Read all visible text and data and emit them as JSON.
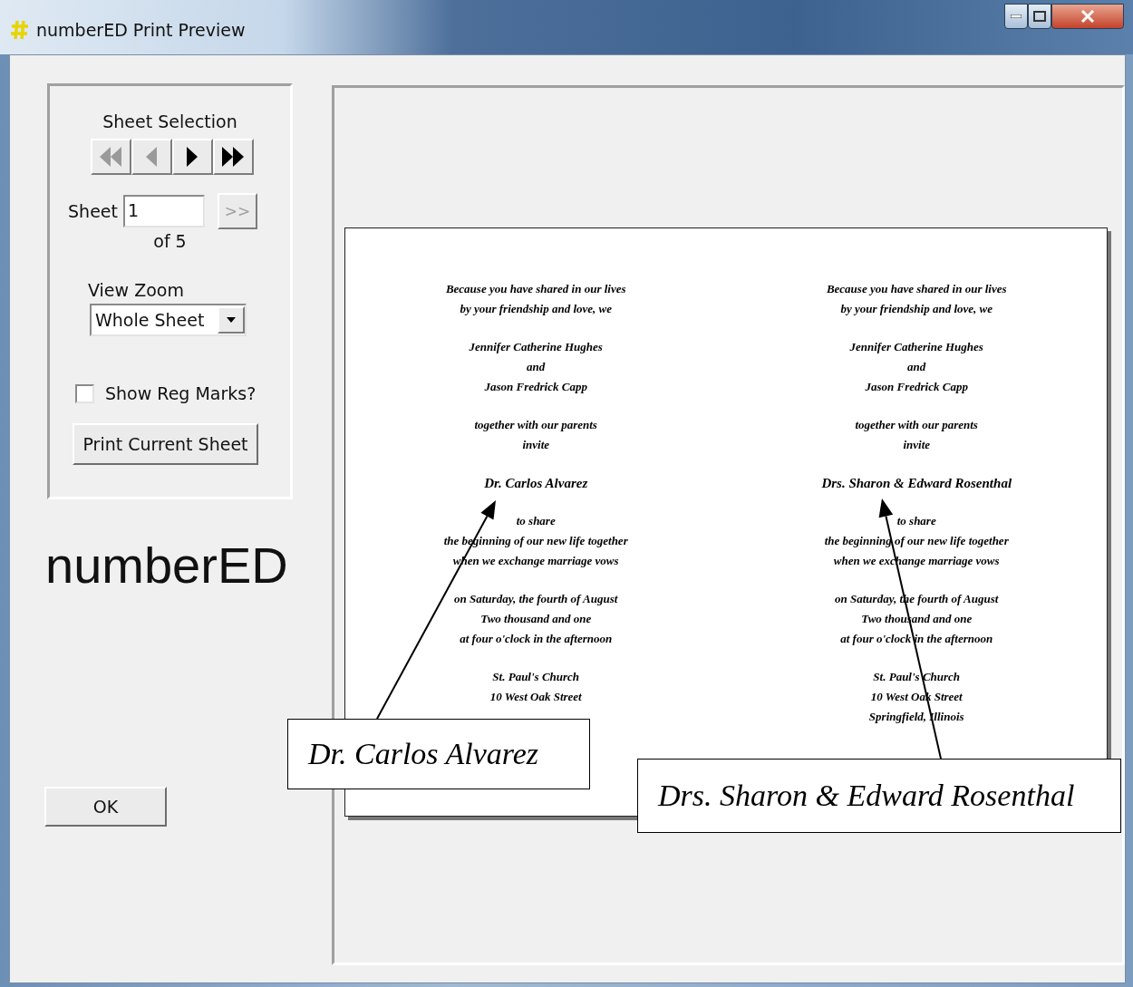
{
  "window": {
    "title": "numberED Print Preview"
  },
  "sheet_selection": {
    "title": "Sheet Selection",
    "nav_buttons": [
      {
        "kind": "first",
        "disabled": true
      },
      {
        "kind": "prev",
        "disabled": true
      },
      {
        "kind": "next",
        "disabled": false
      },
      {
        "kind": "last",
        "disabled": false
      }
    ],
    "sheet_label": "Sheet",
    "sheet_value": "1",
    "go_button": {
      "label": ">>",
      "disabled": true
    },
    "of_label": "of 5",
    "zoom_label": "View Zoom",
    "zoom_value": "Whole Sheet",
    "reg_marks": {
      "label": "Show Reg Marks?",
      "checked": false
    },
    "print_button": "Print Current Sheet"
  },
  "logo": "numberED",
  "ok_button": "OK",
  "sheet": {
    "columns": [
      {
        "blocks": [
          [
            "Because you have shared in our lives",
            "by your friendship and love, we"
          ],
          [
            "Jennifer Catherine Hughes",
            "and",
            "Jason Fredrick Capp"
          ],
          [
            "together with our parents",
            "invite"
          ],
          [
            "Dr. Carlos Alvarez"
          ],
          [
            "to share",
            "the beginning of our new life together",
            "when we exchange marriage vows"
          ],
          [
            "on Saturday, the fourth of August",
            "Two thousand and one",
            "at four o'clock in the afternoon"
          ],
          [
            "St. Paul's Church",
            "10 West Oak Street"
          ]
        ]
      },
      {
        "blocks": [
          [
            "Because you have shared in our lives",
            "by your friendship and love, we"
          ],
          [
            "Jennifer Catherine Hughes",
            "and",
            "Jason Fredrick Capp"
          ],
          [
            "together with our parents",
            "invite"
          ],
          [
            "Drs. Sharon & Edward Rosenthal"
          ],
          [
            "to share",
            "the beginning of our new life together",
            "when we exchange marriage vows"
          ],
          [
            "on Saturday, the fourth of August",
            "Two thousand and one",
            "at four o'clock in the afternoon"
          ],
          [
            "St. Paul's Church",
            "10 West Oak Street",
            "Springfield, Illinois"
          ]
        ]
      }
    ]
  },
  "callouts": [
    "Dr. Carlos Alvarez",
    "Drs. Sharon & Edward Rosenthal"
  ]
}
